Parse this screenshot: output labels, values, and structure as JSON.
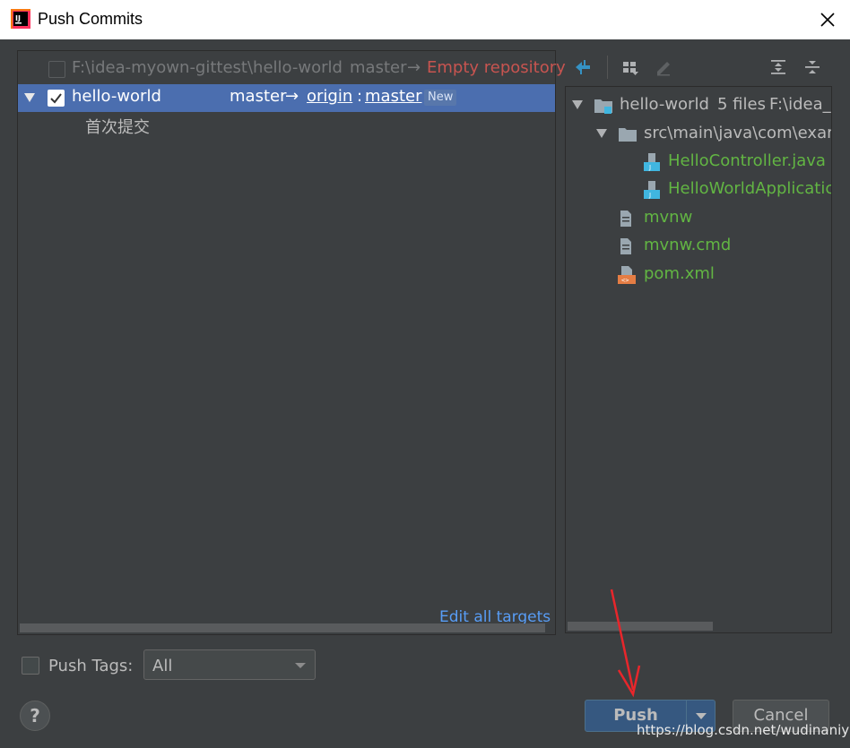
{
  "window": {
    "title": "Push Commits",
    "close_icon": "close-icon"
  },
  "left_panel": {
    "row1": {
      "path": "F:\\idea-myown-gittest\\hello-world",
      "branch": "master",
      "arrow": "→",
      "target": "Empty repository",
      "target_color": "#c75450"
    },
    "row2": {
      "repo": "hello-world",
      "branch": "master",
      "arrow": "→",
      "remote": "origin",
      "sep": ":",
      "remote_branch": "master",
      "badge": "New"
    },
    "commit": "首次提交",
    "edit_all_targets": "Edit all targets"
  },
  "right_panel": {
    "toolbar_icons": [
      "compare-icon",
      "group-by-icon",
      "edit-icon",
      "expand-all-icon",
      "collapse-all-icon"
    ],
    "tree": {
      "root": {
        "name": "hello-world",
        "count": "5 files",
        "path": "F:\\idea_v"
      },
      "folder": {
        "name": "src\\main\\java\\com\\exam"
      },
      "files": [
        {
          "name": "HelloController.java"
        },
        {
          "name": "HelloWorldApplicatic"
        },
        {
          "name": "mvnw"
        },
        {
          "name": "mvnw.cmd"
        },
        {
          "name": "pom.xml"
        }
      ],
      "file_color": "#62b543"
    }
  },
  "bottom": {
    "push_tags_label": "Push Tags:",
    "tags_select_value": "All",
    "help_label": "?",
    "push_label": "Push",
    "cancel_label": "Cancel",
    "watermark": "https://blog.csdn.net/wudinaniya"
  }
}
